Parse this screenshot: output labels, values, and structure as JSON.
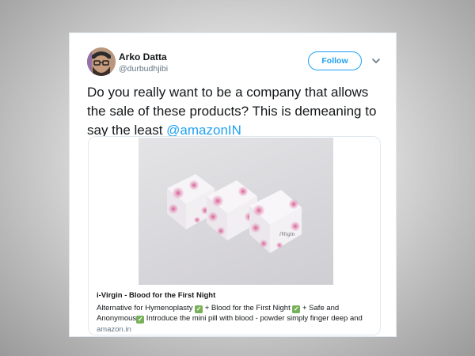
{
  "tweet": {
    "author_name": "Arko Datta",
    "author_handle": "@durbudhjibi",
    "follow_label": "Follow",
    "text": "Do you really want to be a company that allows the sale of these products? This is demeaning to say the least ",
    "mention": "@amazonIN"
  },
  "link_card": {
    "title": "i-Virgin - Blood for the First Night",
    "desc_part1": "Alternative for Hymenoplasty ",
    "desc_part2": " + Blood for the First Night ",
    "desc_part3": " + Safe and Anonymous",
    "desc_part4": " Introduce the mini pill with blood - powder simply finger deep and",
    "domain": "amazon.in",
    "box_lettering": "iVirgin"
  },
  "icons": {
    "checkmark": "white-heavy-check-mark-icon",
    "menu": "chevron-down-icon"
  },
  "colors": {
    "accent": "#1da1f2",
    "text": "#14171a",
    "muted": "#657786",
    "check_green": "#78b159"
  }
}
